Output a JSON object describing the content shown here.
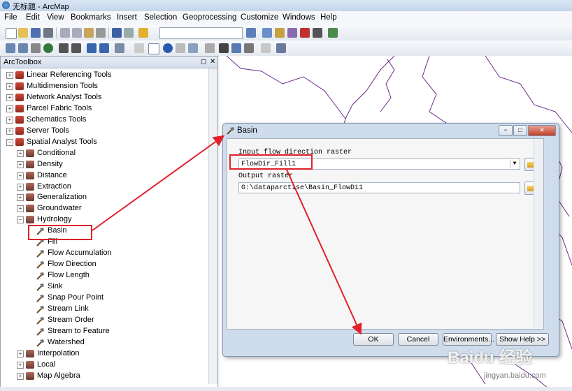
{
  "window": {
    "title": "无标题 - ArcMap"
  },
  "menu": [
    "File",
    "Edit",
    "View",
    "Bookmarks",
    "Insert",
    "Selection",
    "Geoprocessing",
    "Customize",
    "Windows",
    "Help"
  ],
  "toolbox": {
    "title": "ArcToolbox",
    "pin": "◻",
    "close": "✕",
    "items": [
      {
        "label": "Linear Referencing Tools",
        "level": 0,
        "icon": "toolbox-icon",
        "exp": "+"
      },
      {
        "label": "Multidimension Tools",
        "level": 0,
        "icon": "toolbox-icon",
        "exp": "+"
      },
      {
        "label": "Network Analyst Tools",
        "level": 0,
        "icon": "toolbox-icon",
        "exp": "+"
      },
      {
        "label": "Parcel Fabric Tools",
        "level": 0,
        "icon": "toolbox-icon",
        "exp": "+"
      },
      {
        "label": "Schematics Tools",
        "level": 0,
        "icon": "toolbox-icon",
        "exp": "+"
      },
      {
        "label": "Server Tools",
        "level": 0,
        "icon": "toolbox-icon",
        "exp": "+"
      },
      {
        "label": "Spatial Analyst Tools",
        "level": 0,
        "icon": "toolbox-icon",
        "exp": "−"
      },
      {
        "label": "Conditional",
        "level": 1,
        "icon": "toolset-icon",
        "exp": "+"
      },
      {
        "label": "Density",
        "level": 1,
        "icon": "toolset-icon",
        "exp": "+"
      },
      {
        "label": "Distance",
        "level": 1,
        "icon": "toolset-icon",
        "exp": "+"
      },
      {
        "label": "Extraction",
        "level": 1,
        "icon": "toolset-icon",
        "exp": "+"
      },
      {
        "label": "Generalization",
        "level": 1,
        "icon": "toolset-icon",
        "exp": "+"
      },
      {
        "label": "Groundwater",
        "level": 1,
        "icon": "toolset-icon",
        "exp": "+"
      },
      {
        "label": "Hydrology",
        "level": 1,
        "icon": "toolset-icon",
        "exp": "−"
      },
      {
        "label": "Basin",
        "level": 2,
        "icon": "hammer-icon",
        "exp": ""
      },
      {
        "label": "Fill",
        "level": 2,
        "icon": "hammer-icon",
        "exp": ""
      },
      {
        "label": "Flow Accumulation",
        "level": 2,
        "icon": "hammer-icon",
        "exp": ""
      },
      {
        "label": "Flow Direction",
        "level": 2,
        "icon": "hammer-icon",
        "exp": ""
      },
      {
        "label": "Flow Length",
        "level": 2,
        "icon": "hammer-icon",
        "exp": ""
      },
      {
        "label": "Sink",
        "level": 2,
        "icon": "hammer-icon",
        "exp": ""
      },
      {
        "label": "Snap Pour Point",
        "level": 2,
        "icon": "hammer-icon",
        "exp": ""
      },
      {
        "label": "Stream Link",
        "level": 2,
        "icon": "hammer-icon",
        "exp": ""
      },
      {
        "label": "Stream Order",
        "level": 2,
        "icon": "hammer-icon",
        "exp": ""
      },
      {
        "label": "Stream to Feature",
        "level": 2,
        "icon": "hammer-icon",
        "exp": ""
      },
      {
        "label": "Watershed",
        "level": 2,
        "icon": "hammer-icon",
        "exp": ""
      },
      {
        "label": "Interpolation",
        "level": 1,
        "icon": "toolset-icon",
        "exp": "+"
      },
      {
        "label": "Local",
        "level": 1,
        "icon": "toolset-icon",
        "exp": "+"
      },
      {
        "label": "Map Algebra",
        "level": 1,
        "icon": "toolset-icon",
        "exp": "+"
      }
    ]
  },
  "dialog": {
    "title": "Basin",
    "input_label": "Input flow direction raster",
    "input_value": "FlowDir_Fill1",
    "output_label": "Output raster",
    "output_value": "G:\\dataparctise\\Basin_FlowDi1",
    "ok": "OK",
    "cancel": "Cancel",
    "environments": "Environments...",
    "show_help": "Show Help >>",
    "min": "−",
    "max": "□",
    "close": "✕"
  },
  "watermark": "Baidu 经验",
  "watermark_url": "jingyan.baidu.com",
  "colors": {
    "annotation_red": "#e0202a",
    "map_lines": "#6a2a8a"
  }
}
